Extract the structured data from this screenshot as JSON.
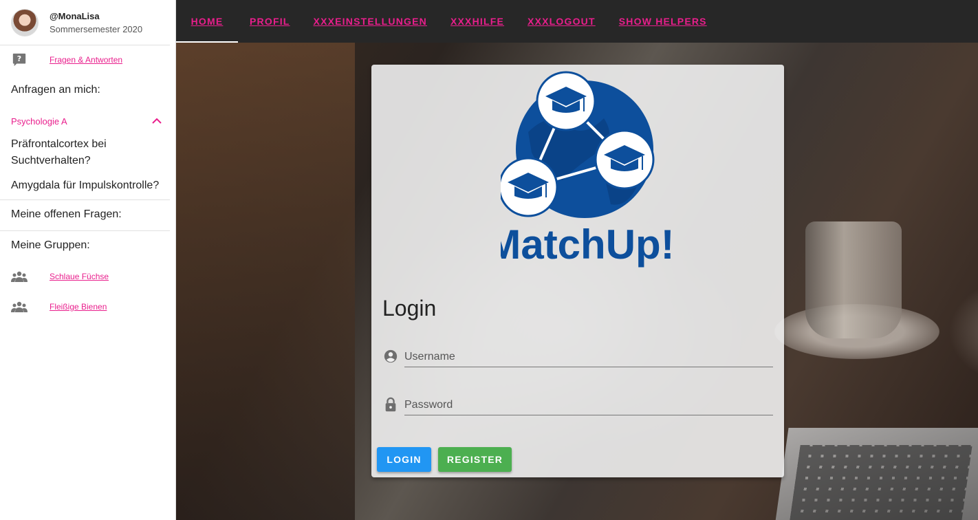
{
  "user": {
    "handle": "@MonaLisa",
    "semester": "Sommersemester 2020"
  },
  "sidebar": {
    "faq_link": "Fragen & Antworten",
    "requests_header": "Anfragen an mich:",
    "course": "Psychologie A",
    "questions": [
      "Präfrontalcortex bei Suchtverhalten?",
      "Amygdala für Impulskontrolle?"
    ],
    "open_questions_header": "Meine offenen Fragen:",
    "groups_header": "Meine Gruppen:",
    "groups": [
      "Schlaue Füchse",
      "Fleißige Bienen"
    ]
  },
  "topnav": {
    "tabs": [
      "HOME",
      "PROFIL",
      "XXXEINSTELLUNGEN",
      "XXXHILFE",
      "XXXLOGOUT",
      "SHOW HELPERS"
    ],
    "active": "HOME"
  },
  "login": {
    "logo_text": "MatchUp!",
    "title": "Login",
    "username_placeholder": "Username",
    "password_placeholder": "Password",
    "login_button": "LOGIN",
    "register_button": "REGISTER"
  },
  "colors": {
    "accent": "#e91e8c",
    "topbar": "#272727",
    "login_button": "#2196f3",
    "register_button": "#4caf50",
    "logo_blue": "#0d4f9c"
  },
  "icons": {
    "faq": "question-bubble-icon",
    "expander": "chevron-up-icon",
    "group": "group-icon",
    "username": "account-circle-icon",
    "password": "lock-icon"
  }
}
